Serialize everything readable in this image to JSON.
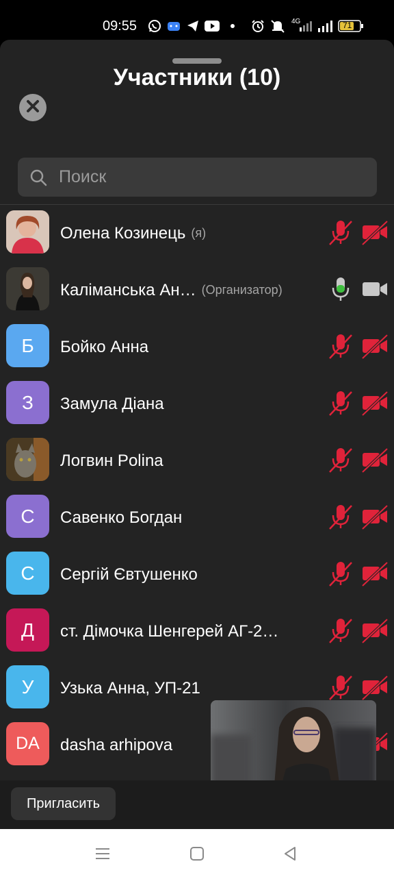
{
  "status_bar": {
    "time": "09:55",
    "notification_icons": [
      "whatsapp-icon",
      "chat-icon",
      "telegram-icon",
      "youtube-icon",
      "dot-icon"
    ],
    "system_icons": [
      "alarm-icon",
      "mute-icon",
      "signal-4g-icon",
      "signal-icon"
    ],
    "network_label": "4G",
    "battery": "71"
  },
  "sheet": {
    "title": "Участники (10)"
  },
  "search": {
    "placeholder": "Поиск"
  },
  "participants": [
    {
      "name": "Олена Козинець",
      "tag": "(я)",
      "avatar_type": "photo",
      "avatar_letter": "",
      "avatar_color": "#c8a08a",
      "mic": "muted",
      "camera": "off"
    },
    {
      "name": "Каліманська Ан…",
      "tag": "(Организатор)",
      "avatar_type": "photo",
      "avatar_letter": "",
      "avatar_color": "#2a2622",
      "mic": "active",
      "camera": "on"
    },
    {
      "name": "Бойко Анна",
      "tag": "",
      "avatar_type": "letter",
      "avatar_letter": "Б",
      "avatar_color": "#5aa8f0",
      "mic": "muted",
      "camera": "off"
    },
    {
      "name": "Замула Діана",
      "tag": "",
      "avatar_type": "letter",
      "avatar_letter": "З",
      "avatar_color": "#8b6fd0",
      "mic": "muted",
      "camera": "off"
    },
    {
      "name": "Логвин Polina",
      "tag": "",
      "avatar_type": "photo",
      "avatar_letter": "",
      "avatar_color": "#6a5a3a",
      "mic": "muted",
      "camera": "off"
    },
    {
      "name": "Савенко Богдан",
      "tag": "",
      "avatar_type": "letter",
      "avatar_letter": "С",
      "avatar_color": "#8b6fd0",
      "mic": "muted",
      "camera": "off"
    },
    {
      "name": "Сергій Євтушенко",
      "tag": "",
      "avatar_type": "letter",
      "avatar_letter": "С",
      "avatar_color": "#49b6ec",
      "mic": "muted",
      "camera": "off"
    },
    {
      "name": "ст. Дімочка Шенгерей АГ-2…",
      "tag": "",
      "avatar_type": "letter",
      "avatar_letter": "Д",
      "avatar_color": "#c51857",
      "mic": "muted",
      "camera": "off"
    },
    {
      "name": "Узька Анна, УП-21",
      "tag": "",
      "avatar_type": "letter",
      "avatar_letter": "У",
      "avatar_color": "#49b6ec",
      "mic": "muted",
      "camera": "off"
    },
    {
      "name": "dasha arhipova",
      "tag": "",
      "avatar_type": "letter",
      "avatar_letter": "DA",
      "avatar_color": "#ee5b5b",
      "mic": "muted",
      "camera": "off"
    }
  ],
  "colors": {
    "muted_red": "#e0233a",
    "mic_active_green": "#3fbf3f",
    "icon_gray": "#c8c8c8"
  },
  "floating_video": {
    "icon": "video-thumbnail"
  },
  "bottom_bar": {
    "invite_label": "Пригласить"
  },
  "nav_bar": {
    "icons": [
      "recents-icon",
      "home-icon",
      "back-icon"
    ]
  }
}
